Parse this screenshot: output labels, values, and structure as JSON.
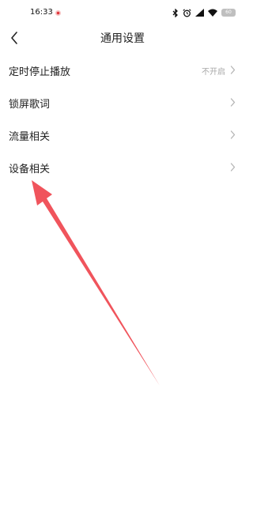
{
  "status_bar": {
    "time": "16:33",
    "battery": "60",
    "icons": [
      "notification-dot-icon",
      "bluetooth-icon",
      "alarm-icon",
      "signal-icon",
      "wifi-icon",
      "battery-icon"
    ]
  },
  "header": {
    "title": "通用设置",
    "back_icon": "chevron-left-icon"
  },
  "settings": {
    "items": [
      {
        "label": "定时停止播放",
        "value": "不开启"
      },
      {
        "label": "锁屏歌词",
        "value": ""
      },
      {
        "label": "流量相关",
        "value": ""
      },
      {
        "label": "设备相关",
        "value": ""
      }
    ]
  },
  "annotation": {
    "type": "arrow",
    "color": "#f0545c",
    "points_to": "设备相关"
  },
  "colors": {
    "background": "#ffffff",
    "text": "#222222",
    "secondary_text": "#a8a8a8",
    "chevron": "#b4b4b4",
    "arrow": "#f0545c"
  }
}
